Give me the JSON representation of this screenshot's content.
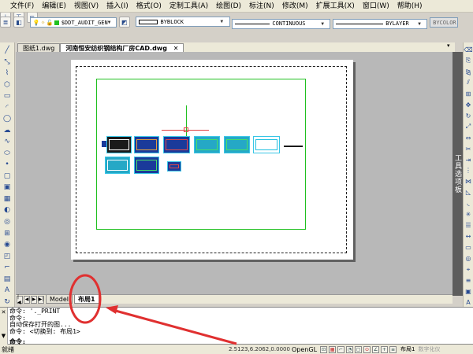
{
  "menu": [
    {
      "label": "文件(F)"
    },
    {
      "label": "编辑(E)"
    },
    {
      "label": "视图(V)"
    },
    {
      "label": "插入(I)"
    },
    {
      "label": "格式(O)"
    },
    {
      "label": "定制工具(A)"
    },
    {
      "label": "绘图(D)"
    },
    {
      "label": "标注(N)"
    },
    {
      "label": "修改(M)"
    },
    {
      "label": "扩展工具(X)"
    },
    {
      "label": "窗口(W)"
    },
    {
      "label": "帮助(H)"
    }
  ],
  "toolbar": {
    "style_combo": "HZ",
    "layer_combo": "$DDT_AUDIT_GEN",
    "color_combo": "BYBLOCK",
    "linetype_combo": "CONTINUOUS",
    "lineweight_combo": "BYLAYER",
    "plotstyle_combo": "BYCOLOR"
  },
  "file_tabs": [
    {
      "label": "图纸1.dwg",
      "active": false
    },
    {
      "label": "河南恒安纺织钢结构厂房CAD.dwg",
      "active": true
    }
  ],
  "tool_palette_label": "工具选项板",
  "layout_tabs": [
    {
      "label": "Model",
      "active": false
    },
    {
      "label": "布局1",
      "active": true
    }
  ],
  "command_history": [
    "命令: '._PRINT",
    "命令:",
    "自动保存打开的图...",
    "命令: <切换到: 布局1>"
  ],
  "command_prompt": "命令:",
  "status": {
    "ready": "就绪",
    "coords": "2.5123,6.2062,0.0000",
    "opengl": "OpenGL",
    "layout": "布局1",
    "digital": "数字化仪"
  },
  "colors": {
    "chrome": "#ece9d8",
    "drawing_bg": "#b8b8b8",
    "viewport": "#20c020",
    "annotation": "#e03030"
  }
}
